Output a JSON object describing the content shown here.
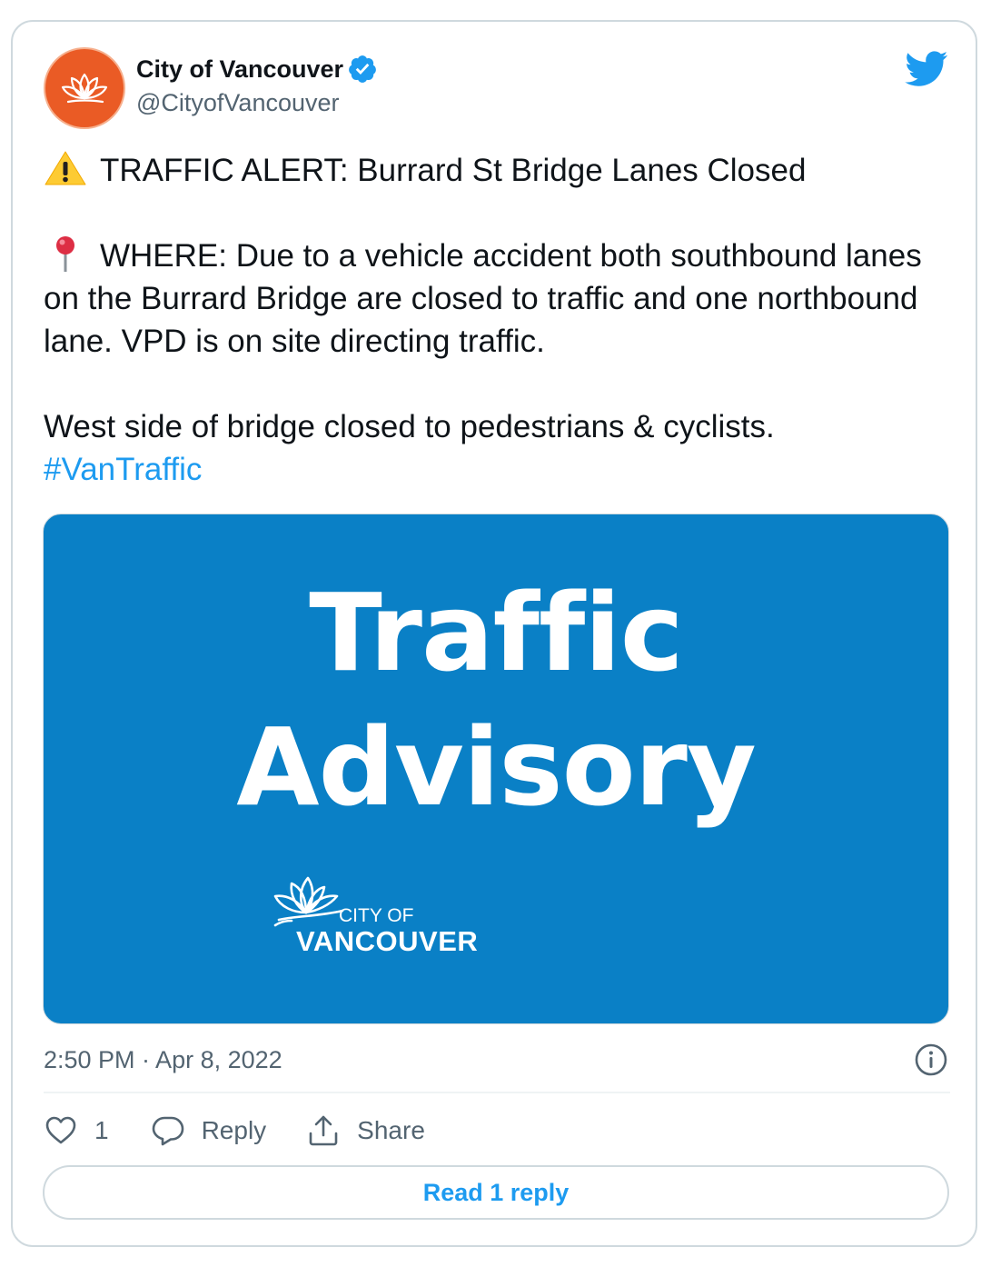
{
  "author": {
    "name": "City of Vancouver",
    "handle": "@CityofVancouver",
    "verified": true,
    "avatar_color": "#ea5b25"
  },
  "tweet": {
    "alert_emoji": "warning-icon",
    "alert_line": "TRAFFIC ALERT: Burrard St Bridge Lanes Closed",
    "where_emoji": "round-pushpin-icon",
    "where_line": "WHERE: Due to a vehicle accident both southbound lanes on the Burrard Bridge are closed to traffic and one northbound lane. VPD is on site directing traffic.",
    "west_line": "West side of bridge closed to pedestrians & cyclists.",
    "hashtag": "#VanTraffic"
  },
  "media": {
    "title_line1": "Traffic",
    "title_line2": "Advisory",
    "logo_city": "CITY OF",
    "logo_vancouver": "VANCOUVER",
    "background_color": "#0a80c6"
  },
  "meta": {
    "timestamp": "2:50 PM · Apr 8, 2022"
  },
  "actions": {
    "like_count": "1",
    "reply_label": "Reply",
    "share_label": "Share",
    "read_replies_label": "Read 1 reply"
  },
  "colors": {
    "accent": "#1d9bf0",
    "text": "#0f1419",
    "muted": "#536471",
    "border": "#cfd9de"
  }
}
